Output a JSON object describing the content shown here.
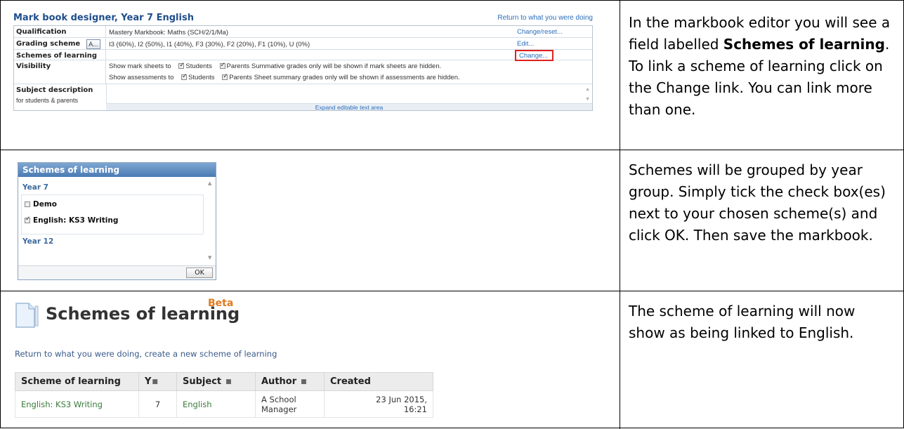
{
  "steps": [
    {
      "caption_parts": [
        "In the markbook editor you will see a field labelled ",
        "Schemes of learning",
        ". To link a scheme of learning click on the Change link. You can link more than one."
      ]
    },
    {
      "caption": "Schemes will be grouped by year group. Simply tick the check box(es) next to your chosen scheme(s) and click OK. Then save the markbook."
    },
    {
      "caption": "The scheme of learning will now show as being linked to English."
    }
  ],
  "markbook_designer": {
    "title": "Mark book designer, Year 7 English",
    "return_link": "Return to what you were doing",
    "rows": {
      "qualification": {
        "label": "Qualification",
        "value": "Mastery Markbook: Maths (SCH/2/1/Ma)",
        "action": "Change/reset..."
      },
      "grading_scheme": {
        "label": "Grading scheme",
        "button": "A...",
        "value": "I3 (60%), I2 (50%), I1 (40%), F3 (30%), F2 (20%), F1 (10%), U (0%)",
        "action": "Edit..."
      },
      "schemes_of_learning": {
        "label": "Schemes of learning",
        "value": "",
        "action": "Change..."
      },
      "visibility": {
        "label": "Visibility",
        "line1_prefix": "Show mark sheets to",
        "line1_suffix": "Summative grades only will be shown if mark sheets are hidden.",
        "line2_prefix": "Show assessments to",
        "line2_suffix": "Sheet summary grades only will be shown if assessments are hidden.",
        "students": "Students",
        "parents": "Parents"
      },
      "subject_description": {
        "label": "Subject description",
        "note": "for students & parents",
        "expand": "Expand editable text area"
      }
    }
  },
  "schemes_popup": {
    "title": "Schemes of learning",
    "groups": [
      "Year 7",
      "Year 12"
    ],
    "items": [
      {
        "label": "Demo",
        "checked": false
      },
      {
        "label": "English: KS3 Writing",
        "checked": true
      }
    ],
    "ok": "OK"
  },
  "schemes_page": {
    "title": "Schemes of learning",
    "badge": "Beta",
    "return_line": "Return to what you were doing, create a new scheme of learning",
    "columns": [
      "Scheme of learning",
      "Y",
      "Subject",
      "Author",
      "Created"
    ],
    "rows": [
      {
        "scheme": "English: KS3 Writing",
        "year": "7",
        "subject": "English",
        "author_line1": "A School",
        "author_line2": "Manager",
        "created_line1": "23 Jun 2015,",
        "created_line2": "16:21"
      }
    ]
  }
}
